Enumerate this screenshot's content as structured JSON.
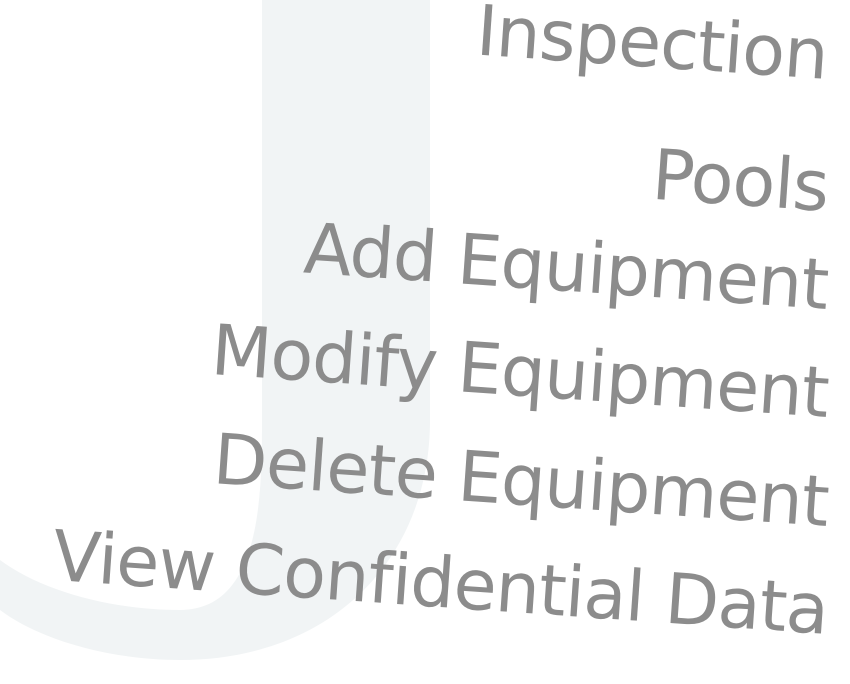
{
  "words": [
    "Inspection",
    "Pools",
    "Add Equipment",
    "Modify Equipment",
    "Delete Equipment",
    "View Confidential Data"
  ],
  "colors": {
    "text": "#8c8c8c",
    "watermark": "#f1f4f5",
    "background": "#ffffff"
  }
}
